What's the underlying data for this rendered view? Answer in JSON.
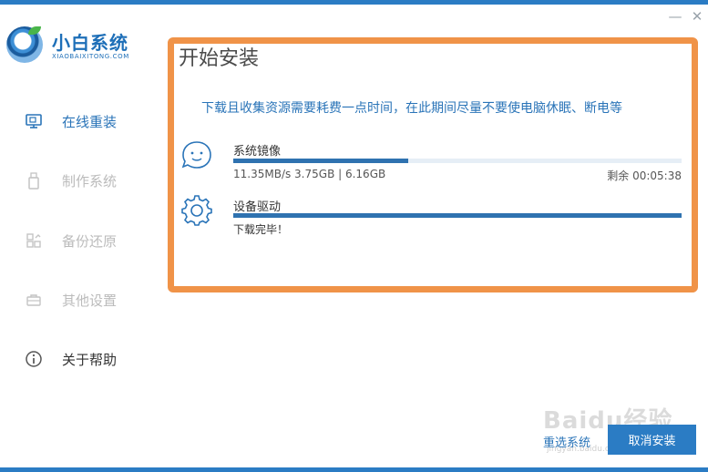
{
  "window": {
    "minimize_glyph": "—",
    "close_glyph": "✕"
  },
  "logo": {
    "title": "小白系统",
    "subtitle": "XIAOBAIXITONG.COM"
  },
  "sidebar": {
    "items": [
      {
        "label": "在线重装",
        "icon": "monitor-icon",
        "active": true
      },
      {
        "label": "制作系统",
        "icon": "usb-icon",
        "active": false
      },
      {
        "label": "备份还原",
        "icon": "backup-icon",
        "active": false
      },
      {
        "label": "其他设置",
        "icon": "toolbox-icon",
        "active": false
      },
      {
        "label": "关于帮助",
        "icon": "info-icon",
        "active": false
      }
    ]
  },
  "main": {
    "title": "开始安装",
    "notice": "下载且收集资源需要耗费一点时间，在此期间尽量不要使电脑休眠、断电等",
    "tasks": [
      {
        "name": "系统镜像",
        "icon": "system-image-icon",
        "stats": "11.35MB/s 3.75GB | 6.16GB",
        "remaining": "剩余 00:05:38",
        "progress": 0.39
      },
      {
        "name": "设备驱动",
        "icon": "gear-icon",
        "status": "下载完毕！",
        "progress": 1.0
      }
    ]
  },
  "footer": {
    "reselect_label": "重选系统",
    "cancel_label": "取消安装"
  },
  "watermark": {
    "text": "Baidu经验",
    "sub": "jingyan.baidu.com"
  },
  "colors": {
    "accent": "#2b7cc4",
    "highlight_frame": "#f09348",
    "progress_fill": "#2f72b0"
  }
}
